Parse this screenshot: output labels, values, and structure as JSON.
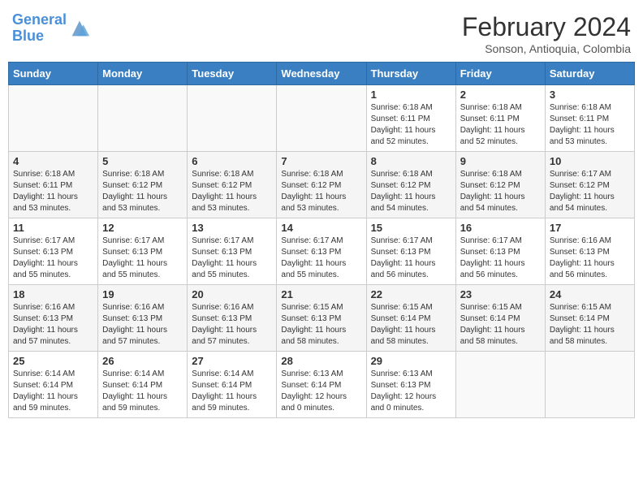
{
  "header": {
    "logo_line1": "General",
    "logo_line2": "Blue",
    "month_title": "February 2024",
    "subtitle": "Sonson, Antioquia, Colombia"
  },
  "weekdays": [
    "Sunday",
    "Monday",
    "Tuesday",
    "Wednesday",
    "Thursday",
    "Friday",
    "Saturday"
  ],
  "weeks": [
    [
      {
        "day": "",
        "info": ""
      },
      {
        "day": "",
        "info": ""
      },
      {
        "day": "",
        "info": ""
      },
      {
        "day": "",
        "info": ""
      },
      {
        "day": "1",
        "info": "Sunrise: 6:18 AM\nSunset: 6:11 PM\nDaylight: 11 hours and 52 minutes."
      },
      {
        "day": "2",
        "info": "Sunrise: 6:18 AM\nSunset: 6:11 PM\nDaylight: 11 hours and 52 minutes."
      },
      {
        "day": "3",
        "info": "Sunrise: 6:18 AM\nSunset: 6:11 PM\nDaylight: 11 hours and 53 minutes."
      }
    ],
    [
      {
        "day": "4",
        "info": "Sunrise: 6:18 AM\nSunset: 6:11 PM\nDaylight: 11 hours and 53 minutes."
      },
      {
        "day": "5",
        "info": "Sunrise: 6:18 AM\nSunset: 6:12 PM\nDaylight: 11 hours and 53 minutes."
      },
      {
        "day": "6",
        "info": "Sunrise: 6:18 AM\nSunset: 6:12 PM\nDaylight: 11 hours and 53 minutes."
      },
      {
        "day": "7",
        "info": "Sunrise: 6:18 AM\nSunset: 6:12 PM\nDaylight: 11 hours and 53 minutes."
      },
      {
        "day": "8",
        "info": "Sunrise: 6:18 AM\nSunset: 6:12 PM\nDaylight: 11 hours and 54 minutes."
      },
      {
        "day": "9",
        "info": "Sunrise: 6:18 AM\nSunset: 6:12 PM\nDaylight: 11 hours and 54 minutes."
      },
      {
        "day": "10",
        "info": "Sunrise: 6:17 AM\nSunset: 6:12 PM\nDaylight: 11 hours and 54 minutes."
      }
    ],
    [
      {
        "day": "11",
        "info": "Sunrise: 6:17 AM\nSunset: 6:13 PM\nDaylight: 11 hours and 55 minutes."
      },
      {
        "day": "12",
        "info": "Sunrise: 6:17 AM\nSunset: 6:13 PM\nDaylight: 11 hours and 55 minutes."
      },
      {
        "day": "13",
        "info": "Sunrise: 6:17 AM\nSunset: 6:13 PM\nDaylight: 11 hours and 55 minutes."
      },
      {
        "day": "14",
        "info": "Sunrise: 6:17 AM\nSunset: 6:13 PM\nDaylight: 11 hours and 55 minutes."
      },
      {
        "day": "15",
        "info": "Sunrise: 6:17 AM\nSunset: 6:13 PM\nDaylight: 11 hours and 56 minutes."
      },
      {
        "day": "16",
        "info": "Sunrise: 6:17 AM\nSunset: 6:13 PM\nDaylight: 11 hours and 56 minutes."
      },
      {
        "day": "17",
        "info": "Sunrise: 6:16 AM\nSunset: 6:13 PM\nDaylight: 11 hours and 56 minutes."
      }
    ],
    [
      {
        "day": "18",
        "info": "Sunrise: 6:16 AM\nSunset: 6:13 PM\nDaylight: 11 hours and 57 minutes."
      },
      {
        "day": "19",
        "info": "Sunrise: 6:16 AM\nSunset: 6:13 PM\nDaylight: 11 hours and 57 minutes."
      },
      {
        "day": "20",
        "info": "Sunrise: 6:16 AM\nSunset: 6:13 PM\nDaylight: 11 hours and 57 minutes."
      },
      {
        "day": "21",
        "info": "Sunrise: 6:15 AM\nSunset: 6:13 PM\nDaylight: 11 hours and 58 minutes."
      },
      {
        "day": "22",
        "info": "Sunrise: 6:15 AM\nSunset: 6:14 PM\nDaylight: 11 hours and 58 minutes."
      },
      {
        "day": "23",
        "info": "Sunrise: 6:15 AM\nSunset: 6:14 PM\nDaylight: 11 hours and 58 minutes."
      },
      {
        "day": "24",
        "info": "Sunrise: 6:15 AM\nSunset: 6:14 PM\nDaylight: 11 hours and 58 minutes."
      }
    ],
    [
      {
        "day": "25",
        "info": "Sunrise: 6:14 AM\nSunset: 6:14 PM\nDaylight: 11 hours and 59 minutes."
      },
      {
        "day": "26",
        "info": "Sunrise: 6:14 AM\nSunset: 6:14 PM\nDaylight: 11 hours and 59 minutes."
      },
      {
        "day": "27",
        "info": "Sunrise: 6:14 AM\nSunset: 6:14 PM\nDaylight: 11 hours and 59 minutes."
      },
      {
        "day": "28",
        "info": "Sunrise: 6:13 AM\nSunset: 6:14 PM\nDaylight: 12 hours and 0 minutes."
      },
      {
        "day": "29",
        "info": "Sunrise: 6:13 AM\nSunset: 6:13 PM\nDaylight: 12 hours and 0 minutes."
      },
      {
        "day": "",
        "info": ""
      },
      {
        "day": "",
        "info": ""
      }
    ]
  ]
}
